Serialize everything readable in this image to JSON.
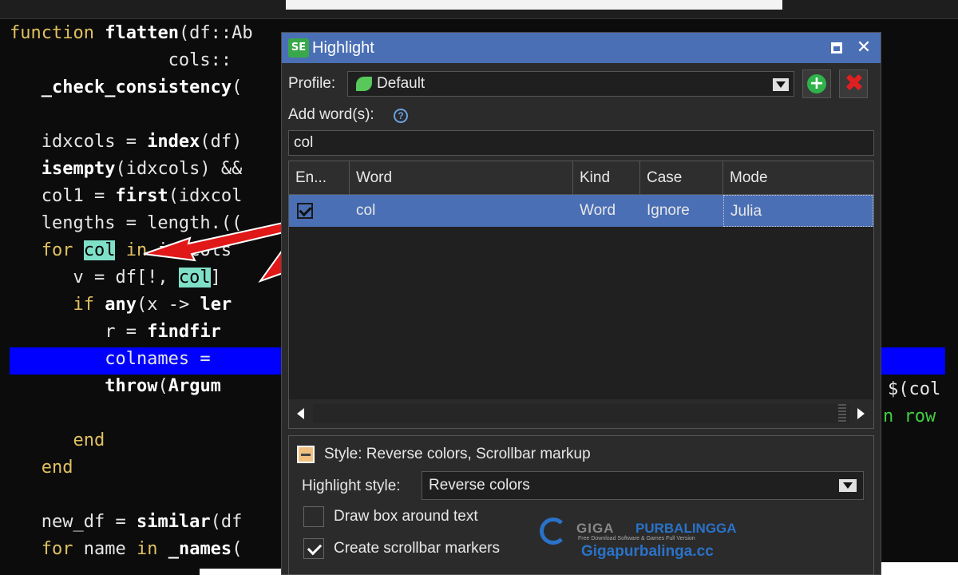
{
  "editor": {
    "lines": [
      {
        "id": "l1",
        "parts": [
          [
            "kw",
            "function "
          ],
          [
            "fn",
            "flatten"
          ],
          [
            "",
            "(df::Ab"
          ]
        ]
      },
      {
        "id": "l2",
        "parts": [
          [
            "",
            "               cols::"
          ]
        ]
      },
      {
        "id": "l3",
        "parts": [
          [
            "",
            "   "
          ],
          [
            "fn",
            "_check_consistency"
          ],
          [
            "",
            "("
          ]
        ]
      },
      {
        "id": "l4",
        "parts": [
          [
            "",
            ""
          ]
        ]
      },
      {
        "id": "l5",
        "parts": [
          [
            "",
            "   idxcols = "
          ],
          [
            "fn",
            "index"
          ],
          [
            "",
            "(df)"
          ]
        ]
      },
      {
        "id": "l6",
        "parts": [
          [
            "",
            "   "
          ],
          [
            "fn",
            "isempty"
          ],
          [
            "",
            "(idxcols) &&"
          ]
        ]
      },
      {
        "id": "l7",
        "parts": [
          [
            "",
            "   col1 = "
          ],
          [
            "fn",
            "first"
          ],
          [
            "",
            "(idxcol"
          ]
        ]
      },
      {
        "id": "l8",
        "parts": [
          [
            "",
            "   lengths = length.(("
          ]
        ]
      },
      {
        "id": "l9",
        "parts": [
          [
            "kw",
            "   for "
          ],
          [
            "hl",
            "col"
          ],
          [
            "kw",
            " in "
          ],
          [
            "",
            "idxcols"
          ]
        ]
      },
      {
        "id": "l10",
        "parts": [
          [
            "",
            "      v = df[!, "
          ],
          [
            "hl",
            "col"
          ],
          [
            "",
            "]"
          ]
        ]
      },
      {
        "id": "l11",
        "parts": [
          [
            "kw",
            "      if "
          ],
          [
            "fn",
            "any"
          ],
          [
            "",
            "(x -> "
          ],
          [
            "fn",
            "ler"
          ]
        ]
      },
      {
        "id": "l12",
        "parts": [
          [
            "",
            "         r = "
          ],
          [
            "fn",
            "findfir"
          ]
        ]
      },
      {
        "id": "l13",
        "parts": [
          [
            "",
            "         colnames = "
          ]
        ]
      },
      {
        "id": "l14",
        "parts": [
          [
            "",
            "         "
          ],
          [
            "fn",
            "throw"
          ],
          [
            "",
            "("
          ],
          [
            "fn",
            "Argum"
          ]
        ]
      },
      {
        "id": "l15",
        "parts": [
          [
            "",
            ""
          ]
        ]
      },
      {
        "id": "l16",
        "parts": [
          [
            "kw",
            "      end"
          ]
        ]
      },
      {
        "id": "l17",
        "parts": [
          [
            "kw",
            "   end"
          ]
        ]
      },
      {
        "id": "l18",
        "parts": [
          [
            "",
            ""
          ]
        ]
      },
      {
        "id": "l19",
        "parts": [
          [
            "",
            "   new_df = "
          ],
          [
            "fn",
            "similar"
          ],
          [
            "",
            "(df"
          ]
        ]
      },
      {
        "id": "l20",
        "parts": [
          [
            "kw",
            "   for "
          ],
          [
            "",
            "name "
          ],
          [
            "kw",
            "in "
          ],
          [
            "fn",
            "_names"
          ],
          [
            "",
            "("
          ]
        ]
      }
    ],
    "right_line_1": "$(col",
    "right_line_2": "n row"
  },
  "dialog": {
    "app_icon": "SE",
    "title": "Highlight",
    "maximize_icon": "maximize-icon",
    "close_glyph": "✕",
    "profile_label": "Profile:",
    "profile_value": "Default",
    "add_words_label": "Add word(s):",
    "help_glyph": "?",
    "word_input_value": "col",
    "table": {
      "columns": [
        "En...",
        "Word",
        "Kind",
        "Case",
        "Mode"
      ],
      "rows": [
        {
          "enabled": true,
          "word": "col",
          "kind": "Word",
          "case": "Ignore",
          "mode": "Julia"
        }
      ]
    },
    "style_summary": "Style: Reverse colors, Scrollbar markup",
    "highlight_style_label": "Highlight style:",
    "highlight_style_value": "Reverse colors",
    "draw_box_label": "Draw box around text",
    "draw_box_checked": false,
    "scrollbar_markers_label": "Create scrollbar markers",
    "scrollbar_markers_checked": true,
    "add_profile_glyph": "+",
    "delete_profile_glyph": "✖"
  },
  "watermark": {
    "brand_gray": "GIGA",
    "brand_blue": "PURBALINGGA",
    "tagline": "Free Download Software & Games Full Version",
    "url": "Gigapurbalinga.cc"
  },
  "colors": {
    "titlebar": "#4a6fb5",
    "selection_line": "#0000ff",
    "match_highlight": "#7fe0c8",
    "arrow": "#e01818"
  }
}
